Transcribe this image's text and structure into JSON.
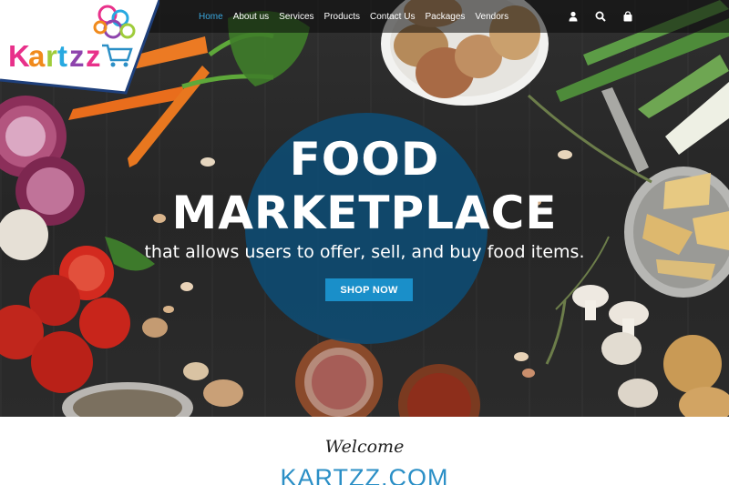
{
  "brand": {
    "logo_text": "Kartzz",
    "logo_colors": [
      "#e8318a",
      "#f08a1c",
      "#27a9e1",
      "#9fcc3b",
      "#8e44ad"
    ]
  },
  "nav": {
    "items": [
      {
        "label": "Home",
        "active": true
      },
      {
        "label": "About us",
        "active": false
      },
      {
        "label": "Services",
        "active": false
      },
      {
        "label": "Products",
        "active": false
      },
      {
        "label": "Contact Us",
        "active": false
      },
      {
        "label": "Packages",
        "active": false
      },
      {
        "label": "Vendors",
        "active": false
      }
    ],
    "icons": [
      "user-icon",
      "search-icon",
      "shopping-bag-icon"
    ],
    "active_color": "#3aa7dd"
  },
  "hero": {
    "title_line1": "FOOD",
    "title_line2": "MARKETPLACE",
    "subtitle": "that allows users to offer, sell, and buy food items.",
    "button_label": "SHOP NOW",
    "button_color": "#1a8fc9",
    "circle_color": "#0f4a70"
  },
  "welcome": {
    "script_text": "Welcome",
    "site_name": "KARTZZ.COM",
    "site_name_color": "#2b8fc6"
  }
}
